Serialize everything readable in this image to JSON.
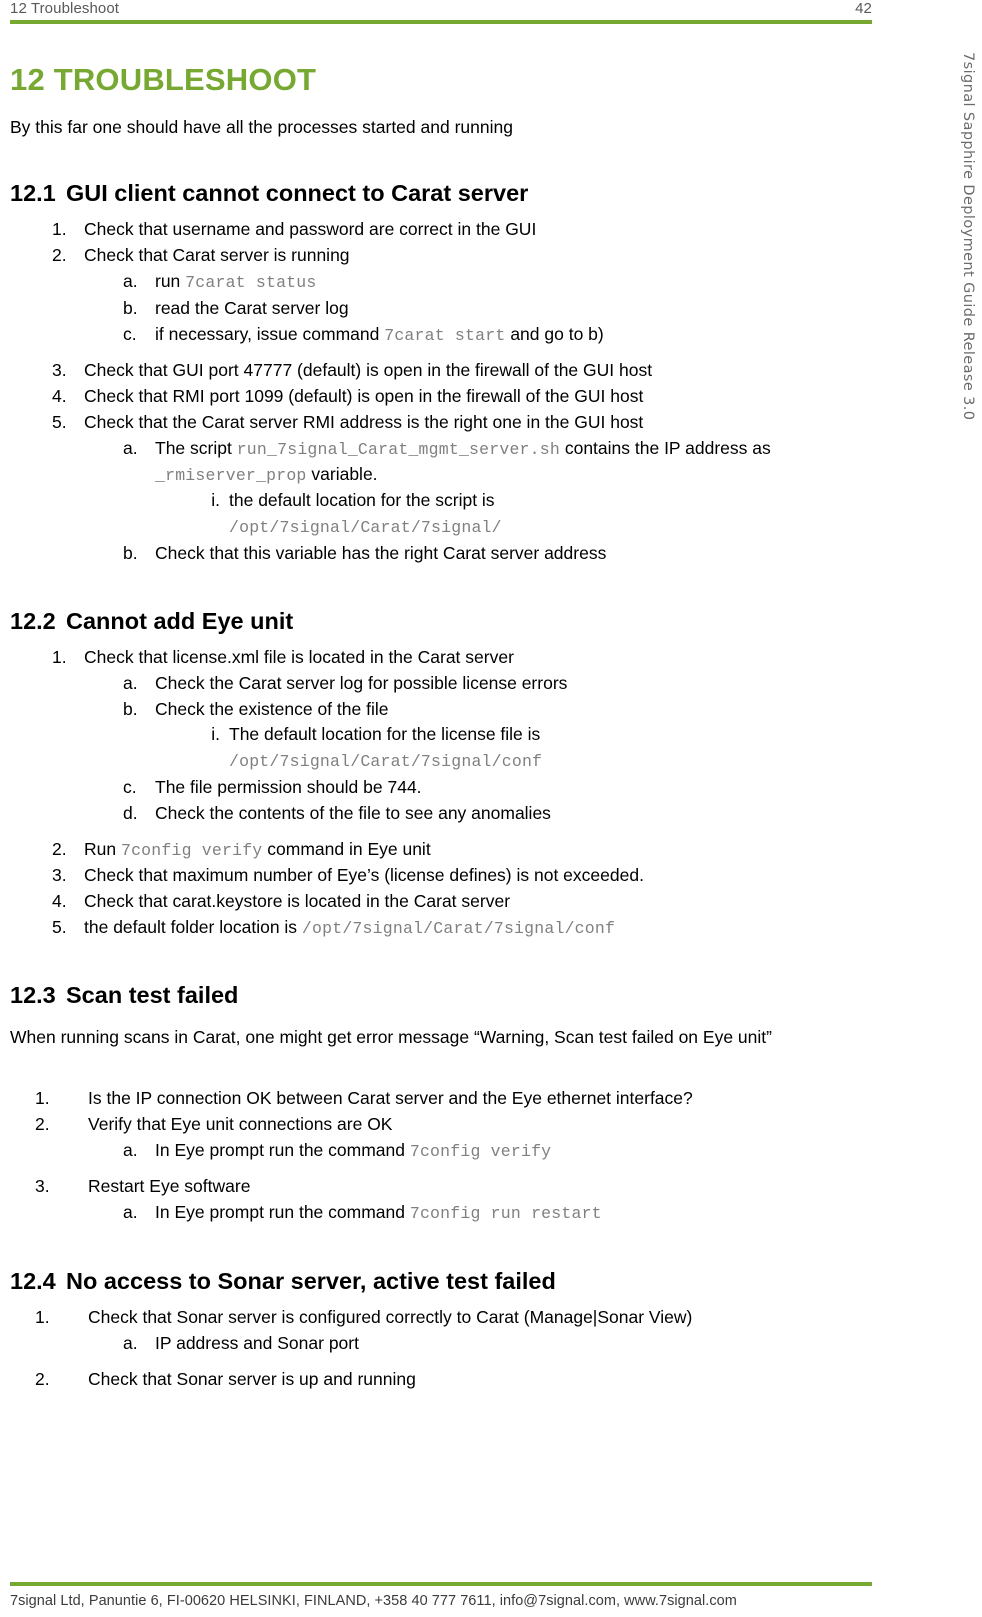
{
  "header": {
    "left": "12 Troubleshoot",
    "page_number": "42",
    "rule_color": "#76A832"
  },
  "side_running_text": "7signal Sapphire Deployment Guide Release 3.0",
  "chapter": {
    "title": "12 TROUBLESHOOT",
    "color": "#76A832",
    "lead": "By this far one should have all the processes started and running"
  },
  "sections": {
    "s1": {
      "number": "12.1",
      "title": "GUI client cannot connect to Carat server",
      "items": {
        "i1": "Check that username and password are correct in the GUI",
        "i2": "Check that Carat server is running",
        "i2a_pre": "run ",
        "i2a_code": "7carat status",
        "i2b": "read the Carat server log",
        "i2c_pre": "if necessary, issue command ",
        "i2c_code": "7carat start",
        "i2c_post": " and go to b)",
        "i3": "Check that GUI port 47777 (default) is open in the firewall of the GUI host",
        "i4": "Check that RMI port 1099 (default) is open in the firewall of the GUI host",
        "i5": "Check that the Carat server RMI address is the right one in the GUI host",
        "i5a_pre": "The script ",
        "i5a_code1": "run_7signal_Carat_mgmt_server.sh",
        "i5a_mid": " contains the IP address as ",
        "i5a_code2": "_rmiserver_prop",
        "i5a_post": " variable.",
        "i5ai_text": "the default location for the script is",
        "i5ai_code": "/opt/7signal/Carat/7signal/",
        "i5b": "Check that this variable has the right Carat server address"
      },
      "markers": {
        "m1": "1.",
        "m2": "2.",
        "m3": "3.",
        "m4": "4.",
        "m5": "5.",
        "ma": "a.",
        "mb": "b.",
        "mc": "c.",
        "mi": "i."
      }
    },
    "s2": {
      "number": "12.2",
      "title": "Cannot add Eye unit",
      "items": {
        "i1": "Check that license.xml file is located in the Carat server",
        "i1a": "Check the Carat server log for possible license errors",
        "i1b": "Check the existence of the file",
        "i1bi_text": "The default location for the license file is",
        "i1bi_code": "/opt/7signal/Carat/7signal/conf",
        "i1c": "The file permission should be 744.",
        "i1d": "Check the contents of the file to see any anomalies",
        "i2_pre": "Run ",
        "i2_code": "7config verify",
        "i2_post": " command in Eye unit",
        "i3": "Check that maximum number of Eye’s (license defines) is not exceeded.",
        "i4": "Check that carat.keystore is located in the Carat server",
        "i5_pre": "the default folder location is ",
        "i5_code": "/opt/7signal/Carat/7signal/conf"
      },
      "markers": {
        "m1": "1.",
        "m2": "2.",
        "m3": "3.",
        "m4": "4.",
        "m5": "5.",
        "ma": "a.",
        "mb": "b.",
        "mc": "c.",
        "md": "d.",
        "mi": "i."
      }
    },
    "s3": {
      "number": "12.3",
      "title": "Scan test failed",
      "paragraph": "When running scans in Carat, one might get error message “Warning, Scan test failed on Eye unit”",
      "items": {
        "i1": "Is the IP connection OK between Carat server and the Eye ethernet interface?",
        "i2": "Verify that Eye unit connections are OK",
        "i2a_pre": "In Eye prompt run the command ",
        "i2a_code": "7config verify",
        "i3": "Restart Eye software",
        "i3a_pre": "In Eye prompt run the command ",
        "i3a_code": "7config run restart"
      },
      "markers": {
        "m1": "1.",
        "m2": "2.",
        "m3": "3.",
        "ma": "a."
      }
    },
    "s4": {
      "number": "12.4",
      "title": "No access to Sonar server, active test failed",
      "items": {
        "i1": "Check that Sonar server is configured correctly to Carat (Manage|Sonar View)",
        "i1a": "IP address and Sonar port",
        "i2": "Check that Sonar server is up and running"
      },
      "markers": {
        "m1": "1.",
        "m2": "2.",
        "ma": "a."
      }
    }
  },
  "footer": {
    "text": "7signal Ltd, Panuntie 6, FI-00620 HELSINKI, FINLAND, +358 40 777 7611, info@7signal.com, www.7signal.com",
    "rule_color": "#76A832"
  }
}
